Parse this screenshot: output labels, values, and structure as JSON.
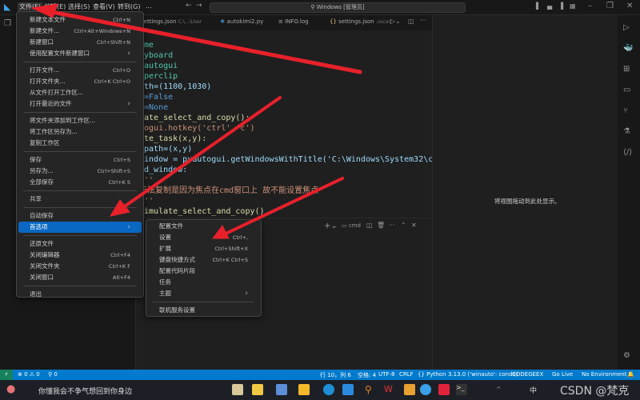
{
  "titlebar": {
    "menus": [
      "文件(F)",
      "编辑(E)",
      "选择(S)",
      "查看(V)",
      "转到(G)",
      "..."
    ],
    "search": "Windows [管理员]"
  },
  "tabs": [
    {
      "label": "settings.json",
      "path": "C:\\...\\User"
    },
    {
      "label": "autokimi2.py"
    },
    {
      "label": "INFO.log"
    },
    {
      "label": "settings.json",
      "path": ".vscod"
    }
  ],
  "code": [
    {
      "t": "ime",
      "c": "#4ec9b0"
    },
    {
      "t": "eyboard",
      "c": "#4ec9b0"
    },
    {
      "t": "yautogui",
      "c": "#4ec9b0"
    },
    {
      "t": "yperclip",
      "c": "#4ec9b0"
    },
    {
      "t": "ath=(1100,1030)",
      "c": "#9cdcfe"
    },
    {
      "t": "e=False",
      "c": "#569cd6"
    },
    {
      "t": "n=None",
      "c": "#569cd6"
    },
    {
      "t": "late_select_and_copy():",
      "c": "#dcdcaa"
    },
    {
      "t": "togui.hotkey('ctrl','c')",
      "c": "#ce9178"
    },
    {
      "t": "ute_task(x,y):",
      "c": "#dcdcaa"
    },
    {
      "t": "_path=(x,y)",
      "c": "#9cdcfe"
    },
    {
      "t": "window = pyautogui.getWindowsWithTitle('C:\\Windows\\System32\\cmd.exe",
      "c": "#9cdcfe"
    },
    {
      "t": "md_window:",
      "c": "#9cdcfe"
    },
    {
      "t": "'''",
      "c": "#ce9178"
    },
    {
      "t": "无法复制是因为焦点在cmd窗口上 故不能设置焦点",
      "c": "#ce9178"
    },
    {
      "t": "'''",
      "c": "#ce9178"
    },
    {
      "t": "simulate_select_and_copy()",
      "c": "#dcdcaa"
    }
  ],
  "panel": {
    "terminal": "cmd"
  },
  "secondary": {
    "empty_text": "将视图拖动到此处显示。"
  },
  "file_menu": [
    {
      "label": "新建文本文件",
      "sc": "Ctrl+N"
    },
    {
      "label": "新建文件...",
      "sc": "Ctrl+Alt+Windows+N"
    },
    {
      "label": "新建窗口",
      "sc": "Ctrl+Shift+N"
    },
    {
      "label": "使用配置文件新建窗口",
      "sub": true
    },
    {
      "sep": true
    },
    {
      "label": "打开文件...",
      "sc": "Ctrl+O"
    },
    {
      "label": "打开文件夹...",
      "sc": "Ctrl+K Ctrl+O"
    },
    {
      "label": "从文件打开工作区..."
    },
    {
      "label": "打开最近的文件",
      "sub": true
    },
    {
      "sep": true
    },
    {
      "label": "将文件夹添加到工作区..."
    },
    {
      "label": "将工作区另存为..."
    },
    {
      "label": "复制工作区"
    },
    {
      "sep": true
    },
    {
      "label": "保存",
      "sc": "Ctrl+S"
    },
    {
      "label": "另存为...",
      "sc": "Ctrl+Shift+S"
    },
    {
      "label": "全部保存",
      "sc": "Ctrl+K S"
    },
    {
      "sep": true
    },
    {
      "label": "共享"
    },
    {
      "sep": true
    },
    {
      "label": "自动保存"
    },
    {
      "label": "首选项",
      "sub": true,
      "selected": true
    },
    {
      "sep": true
    },
    {
      "label": "还原文件"
    },
    {
      "label": "关闭编辑器",
      "sc": "Ctrl+F4"
    },
    {
      "label": "关闭文件夹",
      "sc": "Ctrl+K F"
    },
    {
      "label": "关闭窗口",
      "sc": "Alt+F4"
    },
    {
      "sep": true
    },
    {
      "label": "退出"
    }
  ],
  "prefs_menu": [
    {
      "label": "配置文件"
    },
    {
      "label": "设置",
      "sc": "Ctrl+,"
    },
    {
      "label": "扩展",
      "sc": "Ctrl+Shift+X"
    },
    {
      "label": "键盘快捷方式",
      "sc": "Ctrl+K Ctrl+S"
    },
    {
      "label": "配置代码片段"
    },
    {
      "label": "任务"
    },
    {
      "label": "主题",
      "sub": true
    },
    {
      "sep": true
    },
    {
      "label": "联机服务设置"
    }
  ],
  "status": {
    "errors": "⊗ 0 ⚠ 0",
    "ports": "⚲ 0",
    "position": "行 10，列 6",
    "spaces": "空格: 4",
    "encoding": "UTF-8",
    "eol": "CRLF",
    "language": "{} Python",
    "interpreter": "3.13.0 ('winauto': conda)",
    "codegeex": "CODEGEEX",
    "golive": "Go Live",
    "env": "No Environment"
  },
  "taskbar": {
    "search_text": "你懂我会不争气想回到你身边",
    "ime": "中",
    "watermark": "CSDN @梵克"
  },
  "colors": {
    "accent": "#007acc",
    "selected": "#0a67c2",
    "arrow": "#e8202a"
  }
}
